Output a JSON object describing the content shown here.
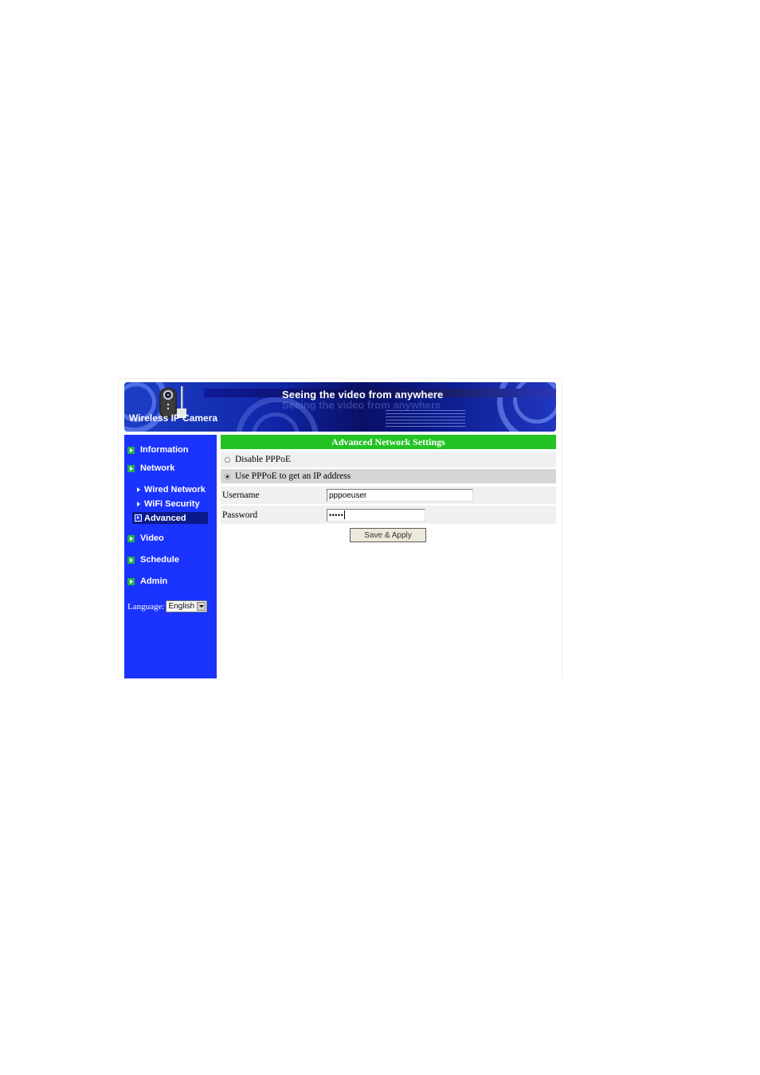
{
  "banner": {
    "slogan": "Seeing the video from anywhere",
    "brand": "Wireless IP Camera"
  },
  "sidebar": {
    "items": [
      {
        "label": "Information"
      },
      {
        "label": "Network"
      },
      {
        "label": "Video"
      },
      {
        "label": "Schedule"
      },
      {
        "label": "Admin"
      }
    ],
    "network_sub": [
      {
        "label": "Wired Network"
      },
      {
        "label": "WiFi Security"
      },
      {
        "label": "Advanced",
        "selected": true
      }
    ],
    "language_label": "Language:",
    "language_value": "English"
  },
  "content": {
    "title": "Advanced Network Settings",
    "options": [
      {
        "label": "Disable PPPoE",
        "checked": false
      },
      {
        "label": "Use PPPoE to get an IP address",
        "checked": true
      }
    ],
    "username_label": "Username",
    "username_value": "pppoeuser",
    "password_label": "Password",
    "password_value": "•••••",
    "save_label": "Save & Apply"
  },
  "colors": {
    "sidebar_bg": "#1a33ff",
    "title_bar": "#22c322",
    "selected_item_bg": "#0a1a8a"
  }
}
